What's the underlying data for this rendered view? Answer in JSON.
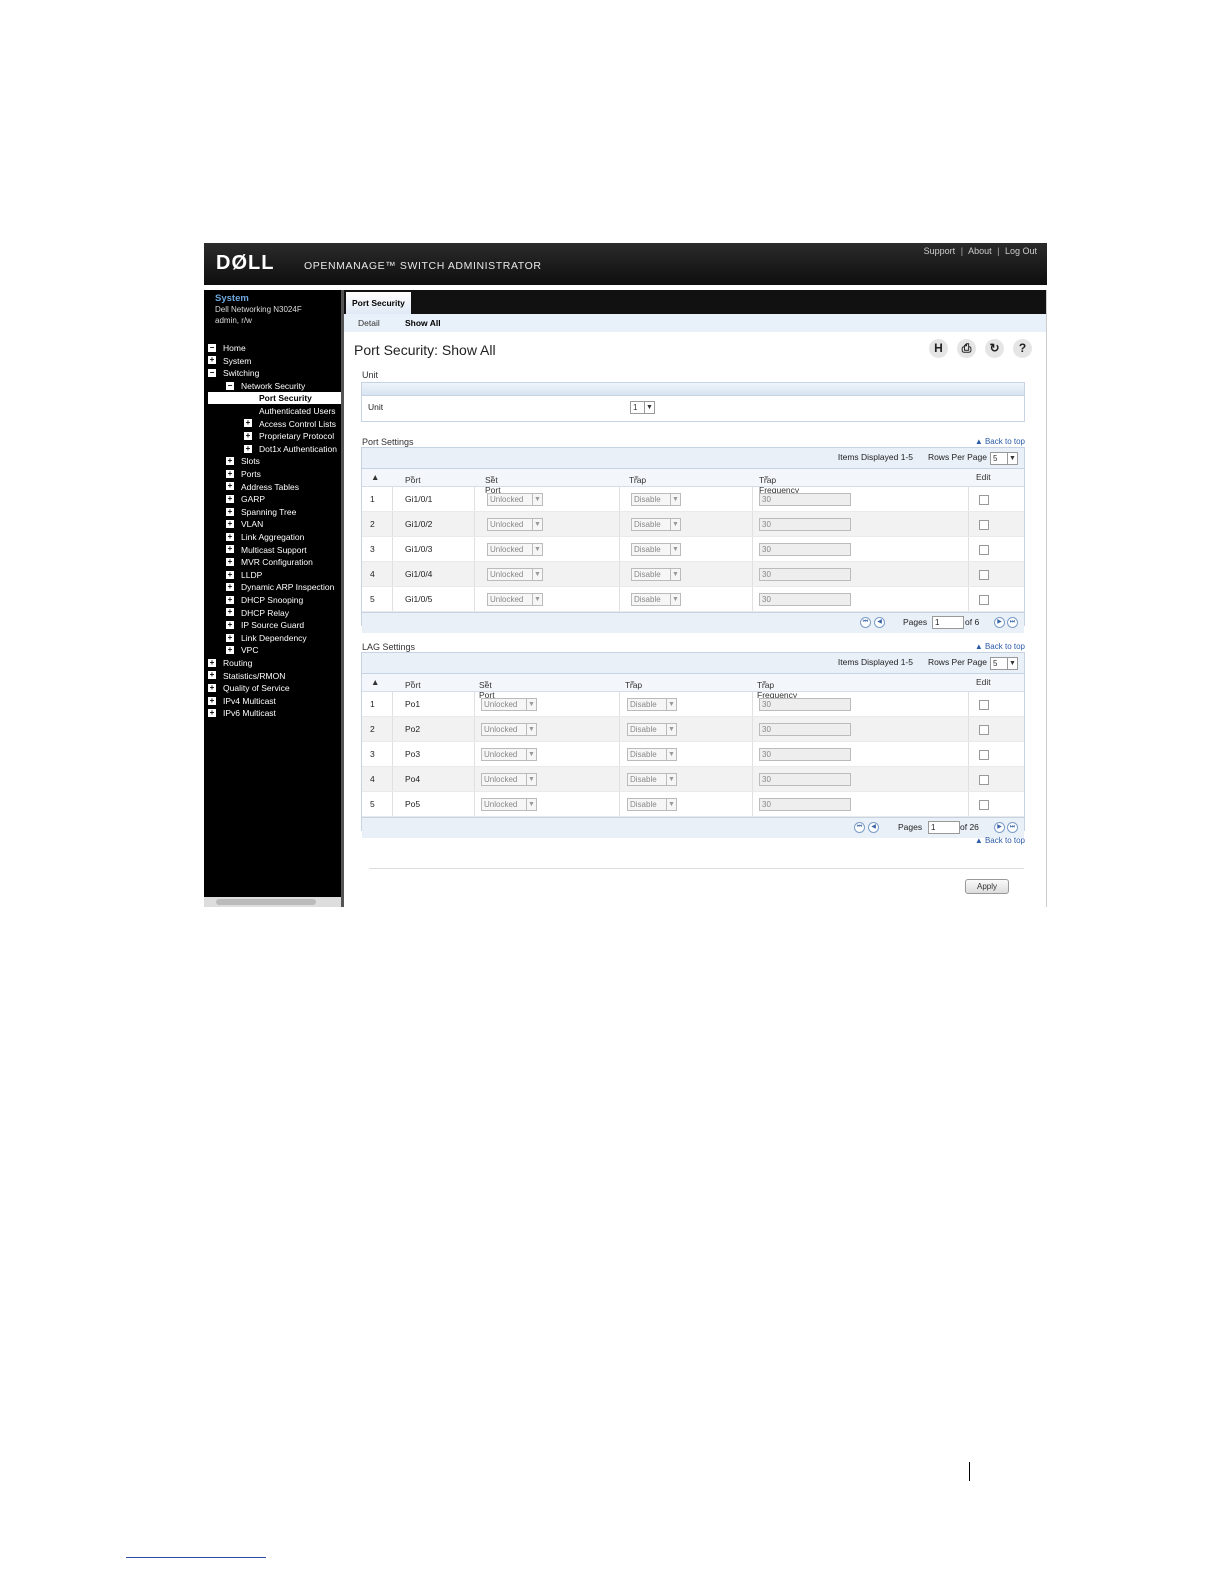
{
  "header": {
    "logo": "DØLL",
    "app_title": "OPENMANAGE™ SWITCH ADMINISTRATOR",
    "links": [
      "Support",
      "About",
      "Log Out"
    ],
    "separator": "|"
  },
  "nav": {
    "system_title": "System",
    "model": "Dell Networking N3024F",
    "user": "admin, r/w",
    "items": [
      {
        "label": "Home",
        "level": 0,
        "icon": "minus"
      },
      {
        "label": "System",
        "level": 0,
        "icon": "plus"
      },
      {
        "label": "Switching",
        "level": 0,
        "icon": "minus"
      },
      {
        "label": "Network Security",
        "level": 1,
        "icon": "minus"
      },
      {
        "label": "Port Security",
        "level": 2,
        "icon": "none",
        "selected": true
      },
      {
        "label": "Authenticated Users",
        "level": 2,
        "icon": "none"
      },
      {
        "label": "Access Control Lists",
        "level": 2,
        "icon": "plus"
      },
      {
        "label": "Proprietary Protocol",
        "level": 2,
        "icon": "plus"
      },
      {
        "label": "Dot1x Authentication",
        "level": 2,
        "icon": "plus"
      },
      {
        "label": "Slots",
        "level": 1,
        "icon": "plus"
      },
      {
        "label": "Ports",
        "level": 1,
        "icon": "plus"
      },
      {
        "label": "Address Tables",
        "level": 1,
        "icon": "plus"
      },
      {
        "label": "GARP",
        "level": 1,
        "icon": "plus"
      },
      {
        "label": "Spanning Tree",
        "level": 1,
        "icon": "plus"
      },
      {
        "label": "VLAN",
        "level": 1,
        "icon": "plus"
      },
      {
        "label": "Link Aggregation",
        "level": 1,
        "icon": "plus"
      },
      {
        "label": "Multicast Support",
        "level": 1,
        "icon": "plus"
      },
      {
        "label": "MVR Configuration",
        "level": 1,
        "icon": "plus"
      },
      {
        "label": "LLDP",
        "level": 1,
        "icon": "plus"
      },
      {
        "label": "Dynamic ARP Inspection",
        "level": 1,
        "icon": "plus"
      },
      {
        "label": "DHCP Snooping",
        "level": 1,
        "icon": "plus"
      },
      {
        "label": "DHCP Relay",
        "level": 1,
        "icon": "plus"
      },
      {
        "label": "IP Source Guard",
        "level": 1,
        "icon": "plus"
      },
      {
        "label": "Link Dependency",
        "level": 1,
        "icon": "plus"
      },
      {
        "label": "VPC",
        "level": 1,
        "icon": "plus"
      },
      {
        "label": "Routing",
        "level": 0,
        "icon": "plus"
      },
      {
        "label": "Statistics/RMON",
        "level": 0,
        "icon": "plus"
      },
      {
        "label": "Quality of Service",
        "level": 0,
        "icon": "plus"
      },
      {
        "label": "IPv4 Multicast",
        "level": 0,
        "icon": "plus"
      },
      {
        "label": "IPv6 Multicast",
        "level": 0,
        "icon": "plus"
      }
    ]
  },
  "tabs": {
    "main": "Port Security",
    "sub": [
      "Detail",
      "Show All"
    ]
  },
  "page": {
    "title": "Port Security: Show All",
    "tool_icons": [
      "save-icon",
      "print-icon",
      "refresh-icon",
      "help-icon"
    ]
  },
  "unit_section": {
    "label": "Unit",
    "field_label": "Unit",
    "value": "1"
  },
  "port_settings": {
    "label": "Port Settings",
    "back_to_top": "Back to top",
    "items_displayed": "Items Displayed 1-5",
    "rows_per_page_label": "Rows Per Page",
    "rows_per_page": "5",
    "columns": [
      "Port",
      "Set Port",
      "Trap",
      "Trap Frequency",
      "Edit"
    ],
    "rows": [
      {
        "num": "1",
        "port": "Gi1/0/1",
        "set_port": "Unlocked",
        "trap": "Disable",
        "freq": "30"
      },
      {
        "num": "2",
        "port": "Gi1/0/2",
        "set_port": "Unlocked",
        "trap": "Disable",
        "freq": "30"
      },
      {
        "num": "3",
        "port": "Gi1/0/3",
        "set_port": "Unlocked",
        "trap": "Disable",
        "freq": "30"
      },
      {
        "num": "4",
        "port": "Gi1/0/4",
        "set_port": "Unlocked",
        "trap": "Disable",
        "freq": "30"
      },
      {
        "num": "5",
        "port": "Gi1/0/5",
        "set_port": "Unlocked",
        "trap": "Disable",
        "freq": "30"
      }
    ],
    "pages_label": "Pages",
    "page": "1",
    "of_pages": "of 6"
  },
  "lag_settings": {
    "label": "LAG Settings",
    "back_to_top": "Back to top",
    "items_displayed": "Items Displayed 1-5",
    "rows_per_page_label": "Rows Per Page",
    "rows_per_page": "5",
    "columns": [
      "Port",
      "Set Port",
      "Trap",
      "Trap Frequency",
      "Edit"
    ],
    "rows": [
      {
        "num": "1",
        "port": "Po1",
        "set_port": "Unlocked",
        "trap": "Disable",
        "freq": "30"
      },
      {
        "num": "2",
        "port": "Po2",
        "set_port": "Unlocked",
        "trap": "Disable",
        "freq": "30"
      },
      {
        "num": "3",
        "port": "Po3",
        "set_port": "Unlocked",
        "trap": "Disable",
        "freq": "30"
      },
      {
        "num": "4",
        "port": "Po4",
        "set_port": "Unlocked",
        "trap": "Disable",
        "freq": "30"
      },
      {
        "num": "5",
        "port": "Po5",
        "set_port": "Unlocked",
        "trap": "Disable",
        "freq": "30"
      }
    ],
    "pages_label": "Pages",
    "page": "1",
    "of_pages": "of 26",
    "back_to_top_bottom": "Back to top"
  },
  "apply_label": "Apply",
  "colors": {
    "nav_bg": "#000000",
    "link_blue": "#2a5aa8",
    "panel_border": "#c5d3e2"
  }
}
